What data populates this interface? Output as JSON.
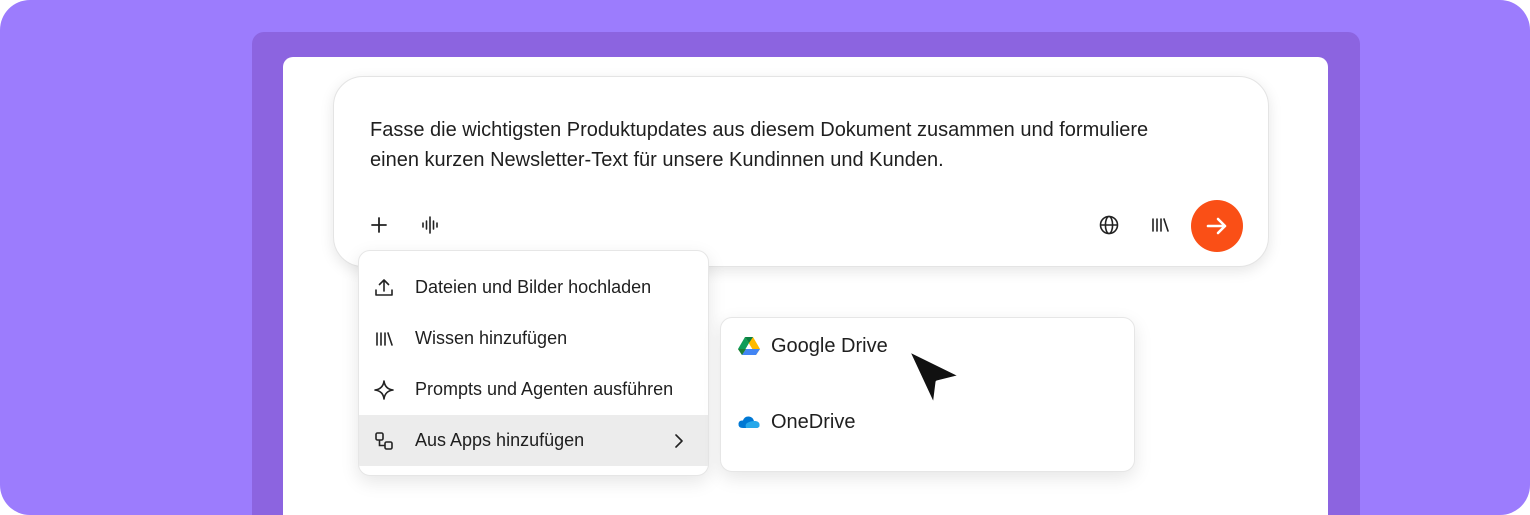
{
  "prompt": {
    "text_line1": "Fasse die wichtigsten Produktupdates aus diesem Dokument zusammen und formuliere",
    "text_line2": "einen kurzen Newsletter-Text für unsere Kundinnen und Kunden."
  },
  "toolbar": {
    "left_icons": [
      "plus-icon",
      "voice-waveform-icon"
    ],
    "right_icons": [
      "globe-icon",
      "library-icon"
    ],
    "send_icon": "arrow-right-icon",
    "send_color": "#fa4f16"
  },
  "menu": {
    "items": [
      {
        "label": "Dateien und Bilder hochladen",
        "icon": "upload-icon"
      },
      {
        "label": "Wissen hinzufügen",
        "icon": "library-icon"
      },
      {
        "label": "Prompts und Agenten ausführen",
        "icon": "sparkle-icon"
      },
      {
        "label": "Aus Apps hinzufügen",
        "icon": "apps-icon",
        "selected": true,
        "has_submenu": true
      }
    ]
  },
  "submenu": {
    "items": [
      {
        "label": "Google Drive",
        "icon": "google-drive-icon"
      },
      {
        "label": "OneDrive",
        "icon": "onedrive-icon"
      }
    ]
  },
  "colors": {
    "frame": "#9c7cfd",
    "backdrop": "#8c64e0",
    "accent": "#fa4f16",
    "selected_row": "#ececec"
  }
}
